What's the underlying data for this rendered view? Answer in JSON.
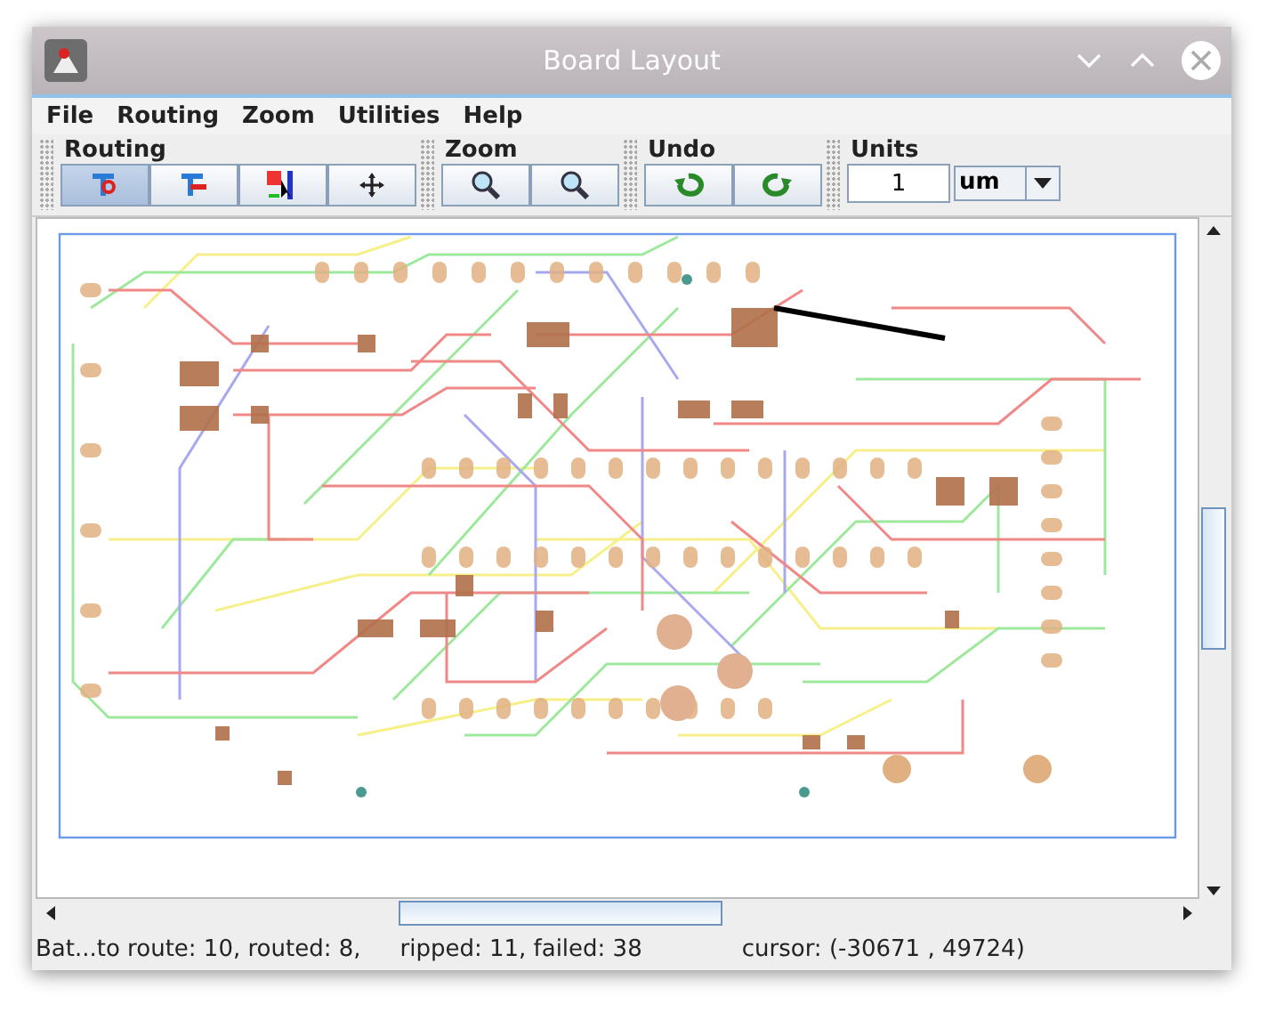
{
  "window": {
    "title": "Board Layout"
  },
  "menu": [
    "File",
    "Routing",
    "Zoom",
    "Utilities",
    "Help"
  ],
  "toolbar": [
    {
      "title": "Routing",
      "buttons": [
        {
          "kind": "route",
          "selected": true
        },
        {
          "kind": "drag",
          "selected": false
        },
        {
          "kind": "select",
          "selected": false
        },
        {
          "kind": "move",
          "selected": false
        }
      ]
    },
    {
      "title": "Zoom",
      "buttons": [
        {
          "kind": "zoom-in",
          "selected": false
        },
        {
          "kind": "zoom-out",
          "selected": false
        }
      ]
    },
    {
      "title": "Undo",
      "buttons": [
        {
          "kind": "undo",
          "selected": false
        },
        {
          "kind": "redo",
          "selected": false
        }
      ]
    }
  ],
  "units": {
    "title": "Units",
    "value": "1",
    "unit": "um"
  },
  "status_bar": [
    "Bat...to route: 10, routed: 8,",
    "ripped: 11, failed: 38",
    "cursor: (-30671 , 49724)"
  ]
}
